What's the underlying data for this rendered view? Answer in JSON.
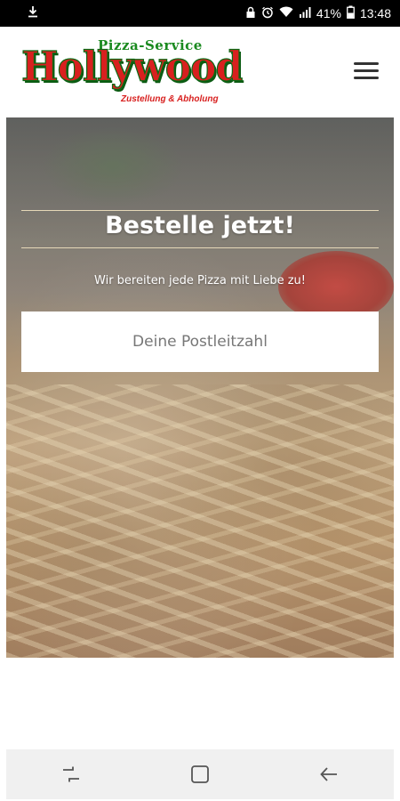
{
  "status_bar": {
    "battery": "41%",
    "time": "13:48",
    "icons": [
      "download-icon",
      "lock-icon",
      "alarm-icon",
      "wifi-icon",
      "signal-icon",
      "battery-icon"
    ]
  },
  "header": {
    "logo": {
      "top_text": "Pizza-Service",
      "main_text": "Hollywood",
      "sub_text": "Zustellung & Abholung"
    },
    "menu_icon": "hamburger-menu-icon"
  },
  "hero": {
    "title": "Bestelle jetzt!",
    "subtitle": "Wir bereiten jede Pizza mit Liebe zu!",
    "zip_input": {
      "placeholder": "Deine Postleitzahl",
      "value": ""
    }
  },
  "nav_bar": {
    "icons": [
      "recent-apps-icon",
      "home-icon",
      "back-icon"
    ]
  },
  "colors": {
    "logo_red": "#d8201f",
    "logo_green": "#1a8a1f",
    "status_bar": "#000000",
    "nav_bar": "#f0f0f0"
  }
}
